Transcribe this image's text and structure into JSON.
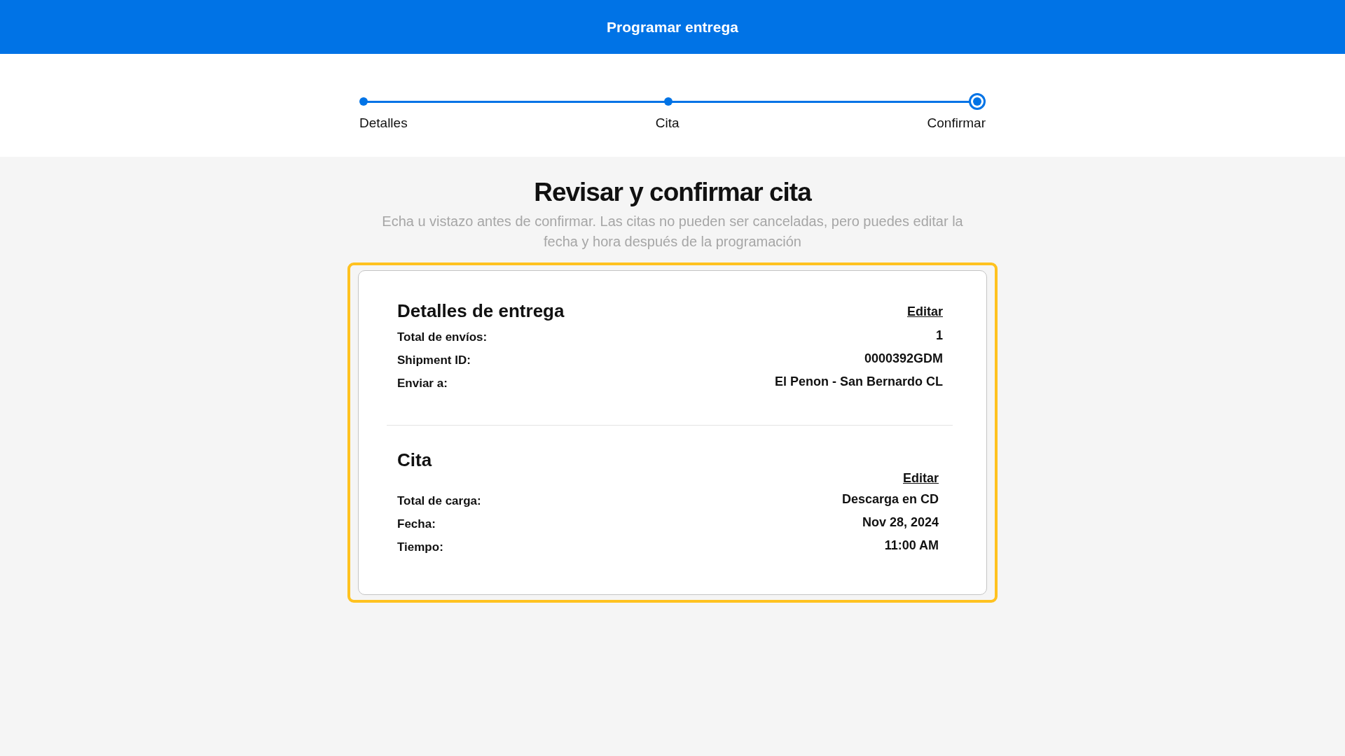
{
  "header": {
    "title": "Programar entrega"
  },
  "steps": [
    {
      "label": "Detalles",
      "selected": false
    },
    {
      "label": "Cita",
      "selected": false
    },
    {
      "label": "Confirmar",
      "selected": true
    }
  ],
  "heading": "Revisar y confirmar cita",
  "subtitle": "Echa u vistazo antes de confirmar. Las citas no pueden ser canceladas, pero puedes editar la fecha y hora después de la programación",
  "sections": [
    {
      "title": "Detalles de entrega",
      "edit_label": "Editar",
      "rows": [
        {
          "label": "Total de envíos:",
          "value": "1"
        },
        {
          "label": "Shipment ID:",
          "value": "0000392GDM"
        },
        {
          "label": "Enviar a:",
          "value": "El Penon - San Bernardo CL"
        }
      ]
    },
    {
      "title": "Cita",
      "edit_label": "Editar",
      "rows": [
        {
          "label": "Total de carga:",
          "value": "Descarga en CD"
        },
        {
          "label": "Fecha:",
          "value": "Nov 28, 2024"
        },
        {
          "label": "Tiempo:",
          "value": "11:00 AM"
        }
      ]
    }
  ]
}
